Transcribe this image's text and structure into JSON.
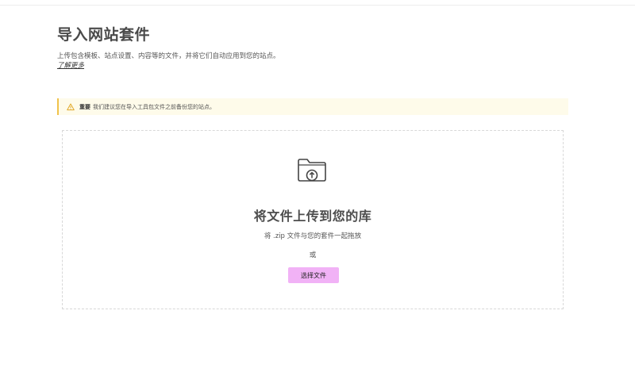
{
  "page": {
    "title": "导入网站套件",
    "description": "上传包含模板、站点设置、内容等的文件，并将它们自动应用到您的站点。",
    "learn_more": "了解更多"
  },
  "notice": {
    "icon": "warning-triangle-icon",
    "label": "重要",
    "text": "我们建议您在导入工具包文件之前备份您的站点。",
    "accent_color": "#f0c24b",
    "background_color": "#fefbea"
  },
  "dropzone": {
    "icon": "folder-upload-icon",
    "title": "将文件上传到您的库",
    "subtitle": "将 .zip 文件与您的套件一起拖放",
    "or_text": "或",
    "button_label": "选择文件",
    "button_color": "#f1b2f6"
  }
}
